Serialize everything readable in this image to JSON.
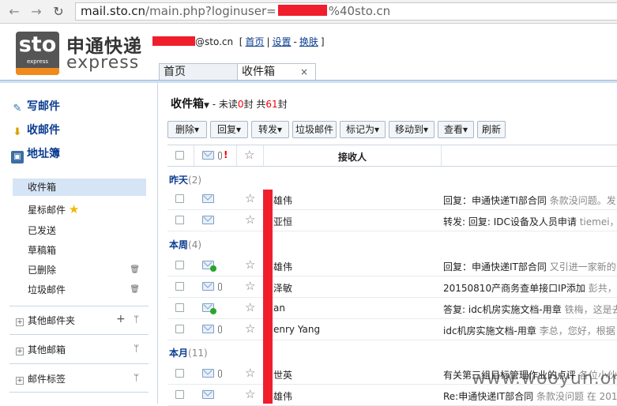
{
  "browser": {
    "url_prefix": "mail.sto.cn",
    "url_path": "/main.php?loginuser=",
    "url_suffix": "%40sto.cn"
  },
  "header": {
    "logo_mark": "sto",
    "logo_mark_small": "express",
    "logo_cn": "申通快递",
    "logo_en": "express",
    "user_domain": "@sto.cn",
    "links": [
      "首页",
      "设置",
      "换肤"
    ]
  },
  "tabs": [
    {
      "label": "首页"
    },
    {
      "label": "收件箱",
      "close": "×"
    }
  ],
  "sidebar": {
    "compose": "写邮件",
    "receive": "收邮件",
    "contacts": "地址簿",
    "folders": [
      {
        "label": "收件箱"
      },
      {
        "label": "星标邮件"
      },
      {
        "label": "已发送"
      },
      {
        "label": "草稿箱"
      },
      {
        "label": "已删除"
      },
      {
        "label": "垃圾邮件"
      }
    ],
    "groups": [
      {
        "label": "其他邮件夹"
      },
      {
        "label": "其他邮箱"
      },
      {
        "label": "邮件标签"
      }
    ]
  },
  "main": {
    "title": "收件箱",
    "summary_pre": "- 未读",
    "unread": "0",
    "summary_mid": "封 共",
    "total": "61",
    "summary_post": "封",
    "toolbar": [
      "删除",
      "回复",
      "转发",
      "垃圾邮件",
      "标记为",
      "移动到",
      "查看",
      "刷新"
    ],
    "column_recipient": "接收人",
    "groups": [
      {
        "label": "昨天",
        "count": "(2)",
        "rows": [
          {
            "sender": "雄伟",
            "subject": "回复：申通快递TI部合同",
            "preview": "条款没问题。发"
          },
          {
            "sender": "亚恒",
            "subject": "转发: 回复: IDC设备及人员申请",
            "preview": "tiemei，"
          }
        ]
      },
      {
        "label": "本周",
        "count": "(4)",
        "rows": [
          {
            "sender": "雄伟",
            "subject": "回复：申通快递IT部合同",
            "preview": "又引进一家新的"
          },
          {
            "sender": "泽敏",
            "subject": "20150810产商务查单接口IP添加",
            "preview": "彭共，"
          },
          {
            "sender": "an",
            "subject": "答复: idc机房实施文档-用章",
            "preview": "铁梅，这是去"
          },
          {
            "sender": "enry Yang",
            "subject": "idc机房实施文档-用章",
            "preview": "李总，您好，根据"
          }
        ]
      },
      {
        "label": "本月",
        "count": "(11)",
        "rows": [
          {
            "sender": "世英",
            "subject": "有关第三组目标管理作业的点评",
            "preview": "各位小伙"
          },
          {
            "sender": "雄伟",
            "subject": "Re:申通快递IT部合同",
            "preview": "条款没问题 在 2015"
          }
        ]
      }
    ]
  },
  "watermark": "www.wooyun.org"
}
